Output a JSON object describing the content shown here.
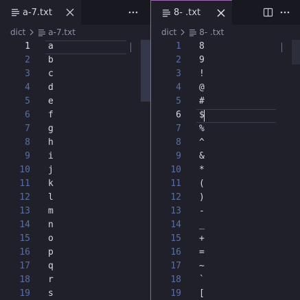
{
  "left_pane": {
    "tab": {
      "label": "a-7.txt",
      "icon": "file-lines-icon"
    },
    "breadcrumb": {
      "folder": "dict",
      "file": "a-7.txt"
    },
    "lines": [
      {
        "n": "1",
        "text": "a"
      },
      {
        "n": "2",
        "text": "b"
      },
      {
        "n": "3",
        "text": "c"
      },
      {
        "n": "4",
        "text": "d"
      },
      {
        "n": "5",
        "text": "e"
      },
      {
        "n": "6",
        "text": "f"
      },
      {
        "n": "7",
        "text": "g"
      },
      {
        "n": "8",
        "text": "h"
      },
      {
        "n": "9",
        "text": "i"
      },
      {
        "n": "10",
        "text": "j"
      },
      {
        "n": "11",
        "text": "k"
      },
      {
        "n": "12",
        "text": "l"
      },
      {
        "n": "13",
        "text": "m"
      },
      {
        "n": "14",
        "text": "n"
      },
      {
        "n": "15",
        "text": "o"
      },
      {
        "n": "16",
        "text": "p"
      },
      {
        "n": "17",
        "text": "q"
      },
      {
        "n": "18",
        "text": "r"
      },
      {
        "n": "19",
        "text": "s"
      }
    ],
    "active_line": "1"
  },
  "right_pane": {
    "tab": {
      "label": "8- .txt",
      "icon": "file-lines-icon"
    },
    "breadcrumb": {
      "folder": "dict",
      "file": "8- .txt"
    },
    "lines": [
      {
        "n": "1",
        "text": "8"
      },
      {
        "n": "2",
        "text": "9"
      },
      {
        "n": "3",
        "text": "!"
      },
      {
        "n": "4",
        "text": "@"
      },
      {
        "n": "5",
        "text": "#"
      },
      {
        "n": "6",
        "text": "$"
      },
      {
        "n": "7",
        "text": "%"
      },
      {
        "n": "8",
        "text": "^"
      },
      {
        "n": "9",
        "text": "&"
      },
      {
        "n": "10",
        "text": "*"
      },
      {
        "n": "11",
        "text": "("
      },
      {
        "n": "12",
        "text": ")"
      },
      {
        "n": "13",
        "text": "-"
      },
      {
        "n": "14",
        "text": "_"
      },
      {
        "n": "15",
        "text": "+"
      },
      {
        "n": "16",
        "text": "="
      },
      {
        "n": "17",
        "text": "~"
      },
      {
        "n": "18",
        "text": "`"
      },
      {
        "n": "19",
        "text": "["
      }
    ],
    "active_line": "6"
  },
  "colors": {
    "accent": "#a46bb8",
    "line_number": "#5a6fa5",
    "text": "#d7d9e0",
    "background": "#1f2029"
  }
}
